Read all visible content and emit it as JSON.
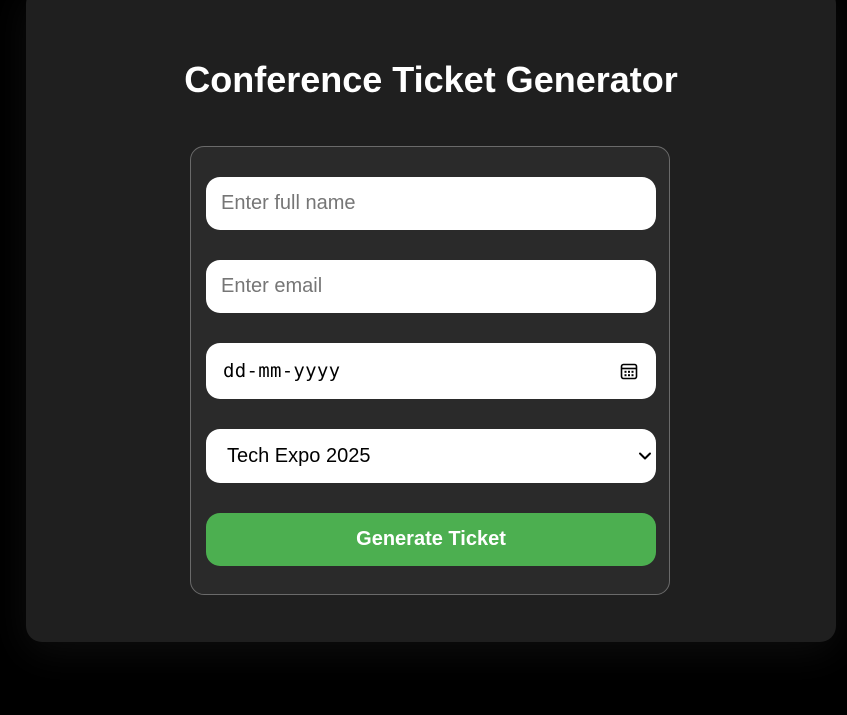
{
  "page": {
    "title": "Conference Ticket Generator"
  },
  "form": {
    "name_placeholder": "Enter full name",
    "email_placeholder": "Enter email",
    "date_placeholder": "dd-mm-yyyy",
    "event_selected": "Tech Expo 2025",
    "generate_label": "Generate Ticket"
  },
  "icons": {
    "date": "calendar-icon",
    "select": "chevron-down-icon"
  },
  "colors": {
    "page_background": "#000000",
    "card_background": "#1f1f1f",
    "form_background": "#2a2a2a",
    "button_accent": "#4caf50",
    "text_light": "#ffffff"
  }
}
